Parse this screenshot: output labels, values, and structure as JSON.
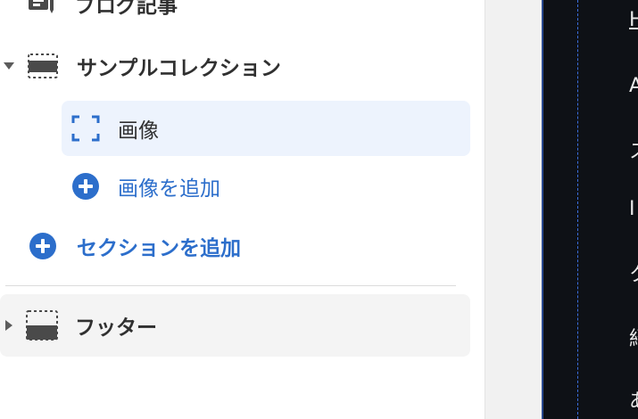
{
  "sidebar": {
    "items": [
      {
        "label": "ブログ記事",
        "icon": "blog-post-icon"
      },
      {
        "label": "サンプルコレクション",
        "icon": "section-icon",
        "expanded": true
      },
      {
        "label": "画像",
        "icon": "image-block-icon",
        "selected": true
      },
      {
        "label": "画像を追加",
        "icon": "add-circle-icon",
        "color": "#2c6ecb"
      },
      {
        "label": "セクションを追加",
        "icon": "add-circle-icon",
        "color": "#2c6ecb"
      },
      {
        "label": "フッター",
        "icon": "footer-icon",
        "expanded": false
      }
    ]
  },
  "preview": {
    "lines": [
      "H",
      "A",
      "ス",
      "I",
      "ク",
      "紹",
      "あ"
    ]
  },
  "colors": {
    "accent": "#2c6ecb",
    "selected_bg": "#edf3fd",
    "preview_bg": "#0e1116"
  }
}
